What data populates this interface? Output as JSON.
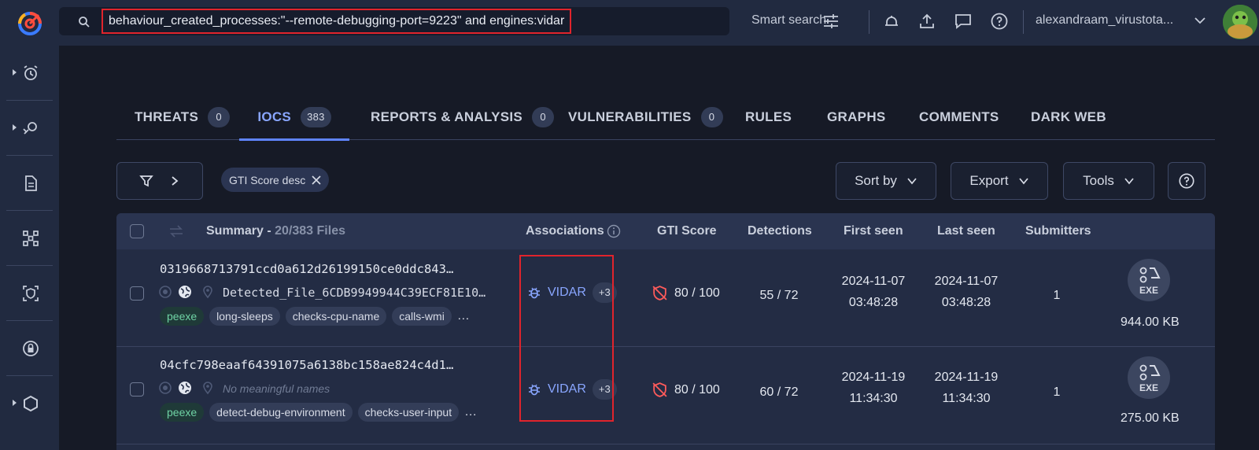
{
  "search": {
    "query": "behaviour_created_processes:\"--remote-debugging-port=9223\" and engines:vidar"
  },
  "topbar": {
    "smart_search": "Smart search",
    "username": "alexandraam_virustota..."
  },
  "tabs": [
    {
      "label": "THREATS",
      "count": "0"
    },
    {
      "label": "IOCS",
      "count": "383"
    },
    {
      "label": "REPORTS & ANALYSIS",
      "count": "0"
    },
    {
      "label": "VULNERABILITIES",
      "count": "0"
    },
    {
      "label": "RULES"
    },
    {
      "label": "GRAPHS"
    },
    {
      "label": "COMMENTS"
    },
    {
      "label": "DARK WEB"
    }
  ],
  "filters": {
    "chip": "GTI Score desc",
    "sort_by": "Sort by",
    "export": "Export",
    "tools": "Tools"
  },
  "table": {
    "headers": {
      "summary": "Summary - ",
      "summary_count": "20/383 Files",
      "associations": "Associations",
      "gti_score": "GTI Score",
      "detections": "Detections",
      "first_seen": "First seen",
      "last_seen": "Last seen",
      "submitters": "Submitters"
    },
    "rows": [
      {
        "hash": "0319668713791ccd0a612d26199150ce0ddc843…",
        "name": "Detected_File_6CDB9949944C39ECF81E10…",
        "tags": [
          "peexe",
          "long-sleeps",
          "checks-cpu-name",
          "calls-wmi"
        ],
        "more": "…",
        "association": "VIDAR",
        "association_more": "+3",
        "gti": "80 / 100",
        "detections": "55 / 72",
        "first_seen_date": "2024-11-07",
        "first_seen_time": "03:48:28",
        "last_seen_date": "2024-11-07",
        "last_seen_time": "03:48:28",
        "submitters": "1",
        "file_type": "EXE",
        "size": "944.00 KB"
      },
      {
        "hash": "04cfc798eaaf64391075a6138bc158ae824c4d1…",
        "name": "No meaningful names",
        "tags": [
          "peexe",
          "detect-debug-environment",
          "checks-user-input"
        ],
        "more": "…",
        "association": "VIDAR",
        "association_more": "+3",
        "gti": "80 / 100",
        "detections": "60 / 72",
        "first_seen_date": "2024-11-19",
        "first_seen_time": "11:34:30",
        "last_seen_date": "2024-11-19",
        "last_seen_time": "11:34:30",
        "submitters": "1",
        "file_type": "EXE",
        "size": "275.00 KB"
      }
    ]
  },
  "colors": {
    "accent": "#89a6ff",
    "highlight": "#e0242c",
    "tag_green": "#6fd3a4"
  },
  "icons": [
    "logo-icon",
    "search-icon",
    "tune-icon",
    "bell-icon",
    "upload-icon",
    "chat-icon",
    "help-icon",
    "chevron-down-icon",
    "filter-icon",
    "close-icon",
    "info-icon",
    "bug-icon",
    "shield-off-icon",
    "eye-icon",
    "globe-icon",
    "pin-icon",
    "file-exe-icon"
  ]
}
